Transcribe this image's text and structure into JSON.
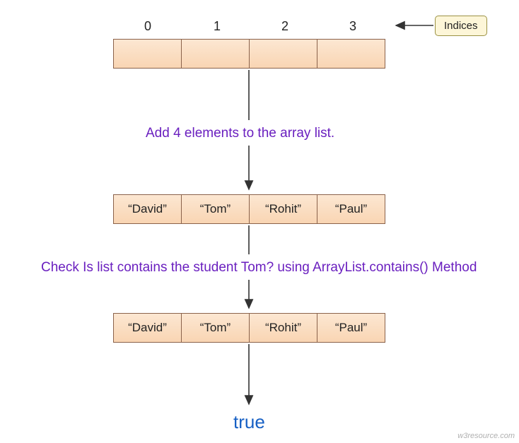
{
  "indices_label": "Indices",
  "index_numbers": [
    "0",
    "1",
    "2",
    "3"
  ],
  "row1_cells": [
    "",
    "",
    "",
    ""
  ],
  "caption1": "Add 4 elements to the array list.",
  "row2_cells": [
    "“David”",
    "“Tom”",
    "“Rohit”",
    "“Paul”"
  ],
  "caption2": "Check Is list contains the student Tom? using ArrayList.contains() Method",
  "row3_cells": [
    "“David”",
    "“Tom”",
    "“Rohit”",
    "“Paul”"
  ],
  "result": "true",
  "watermark": "w3resource.com",
  "colors": {
    "caption": "#6a1fbf",
    "result": "#1760c4",
    "cell_border": "#8a624b"
  }
}
